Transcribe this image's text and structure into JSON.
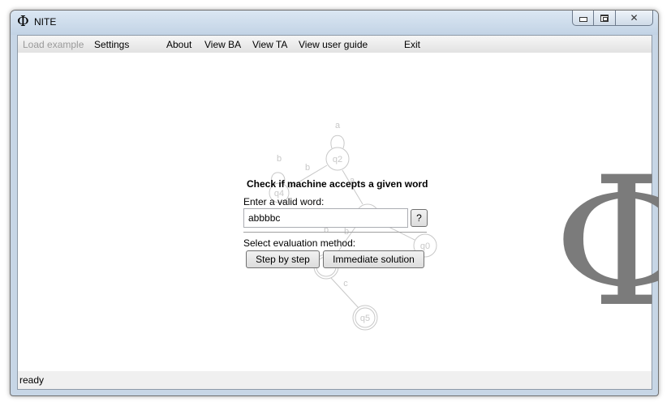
{
  "window": {
    "title": "NITE",
    "app_icon_glyph": "Φ"
  },
  "menu": {
    "items": [
      {
        "label": "Load example",
        "enabled": false
      },
      {
        "label": "Settings",
        "enabled": true
      },
      {
        "label": "About",
        "enabled": true
      },
      {
        "label": "View BA",
        "enabled": true
      },
      {
        "label": "View TA",
        "enabled": true
      },
      {
        "label": "View user guide",
        "enabled": true
      },
      {
        "label": "Exit",
        "enabled": true
      }
    ]
  },
  "logo": {
    "glyph": "Φ",
    "color": "#7b7b7b"
  },
  "graph": {
    "states": [
      "q2",
      "q4",
      "q0",
      "q5"
    ],
    "labels": [
      "a",
      "b",
      "b",
      "a",
      "b",
      "b",
      "c"
    ],
    "color": "#c8c8c8"
  },
  "dialog": {
    "title": "Check if machine accepts a given word",
    "word_label": "Enter a valid word:",
    "word_value": "abbbbc",
    "help_label": "?",
    "method_label": "Select evaluation method:",
    "step_button": "Step by step",
    "immediate_button": "Immediate solution"
  },
  "status": {
    "text": "ready"
  }
}
